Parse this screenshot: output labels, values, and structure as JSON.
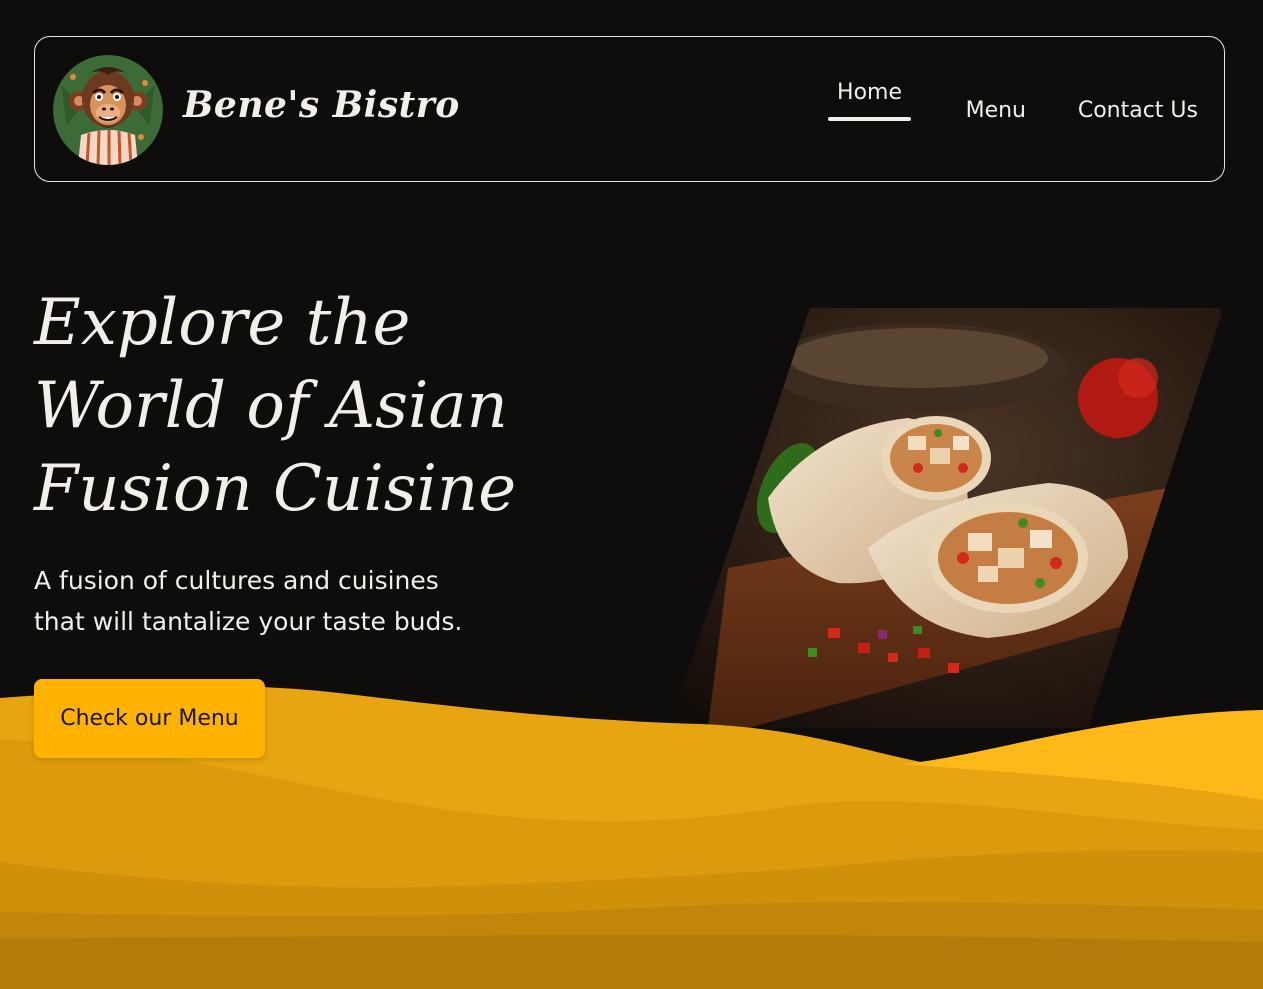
{
  "header": {
    "brand_name": "Bene's Bistro",
    "logo_icon": "monkey-mascot-logo",
    "nav": [
      {
        "label": "Home",
        "active": true
      },
      {
        "label": "Menu",
        "active": false
      },
      {
        "label": "Contact Us",
        "active": false
      }
    ]
  },
  "hero": {
    "title_lines": [
      "Explore the",
      "World of Asian",
      "Fusion Cuisine"
    ],
    "subtitle_lines": [
      "A fusion of cultures and cuisines",
      "that will tantalize your taste buds."
    ],
    "cta_label": "Check our Menu",
    "image_subject": "chicken-wrap-photo"
  },
  "colors": {
    "background": "#0e0d0c",
    "text": "#f2efe9",
    "accent": "#ffb300",
    "wave_1": "#e7a511",
    "wave_2": "#dc9b0c",
    "wave_3": "#cf900a",
    "wave_4": "#c2860a",
    "wave_5": "#b47b08"
  }
}
